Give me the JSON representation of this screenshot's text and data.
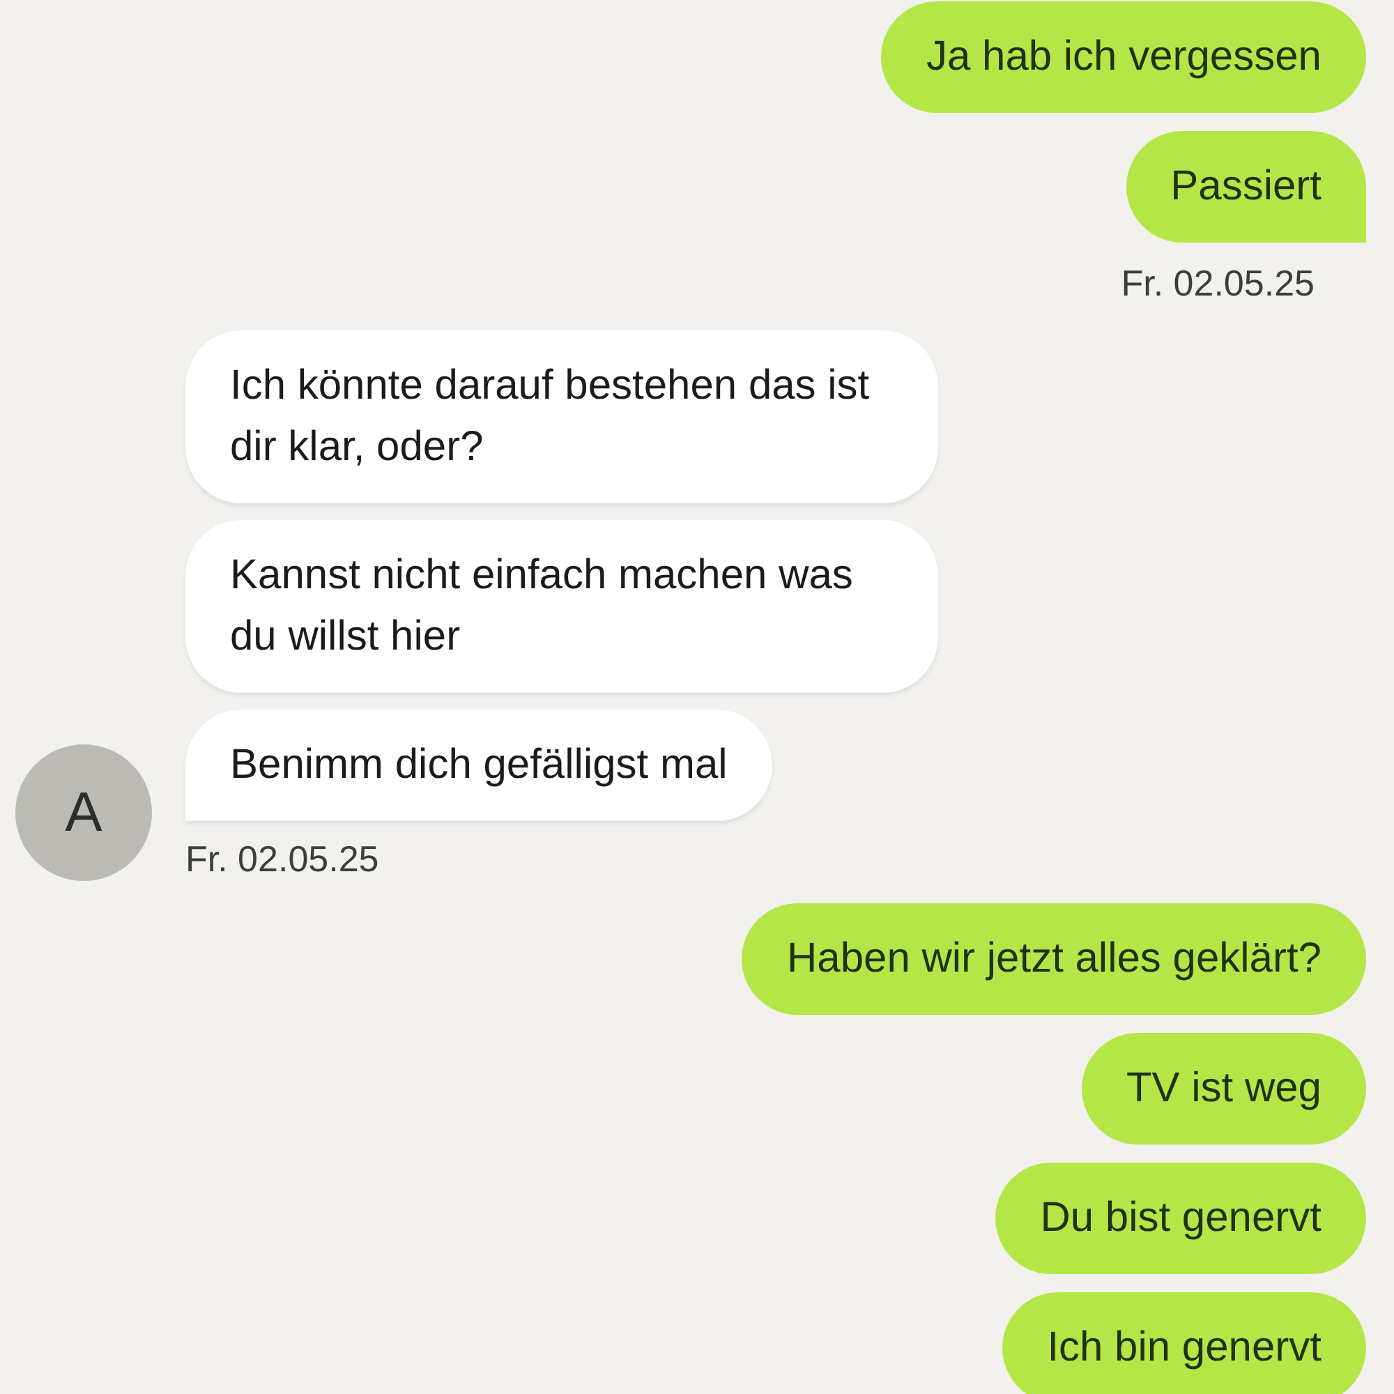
{
  "groups": [
    {
      "kind": "outgoing",
      "messages": [
        {
          "text": "Ja hab ich vergessen",
          "tail": false
        },
        {
          "text": "Passiert",
          "tail": true
        }
      ],
      "time": "Fr. 02.05.25"
    },
    {
      "kind": "incoming",
      "avatar": "A",
      "messages": [
        {
          "text": "Ich könnte darauf bestehen das ist dir klar, oder?",
          "tail": false
        },
        {
          "text": "Kannst nicht einfach machen was du willst hier",
          "tail": false
        },
        {
          "text": "Benimm dich gefälligst mal",
          "tail": true
        }
      ],
      "time": "Fr. 02.05.25"
    },
    {
      "kind": "outgoing",
      "messages": [
        {
          "text": "Haben wir jetzt alles geklärt?",
          "tail": false
        },
        {
          "text": "TV ist weg",
          "tail": false
        },
        {
          "text": "Du bist genervt",
          "tail": false
        },
        {
          "text": "Ich bin genervt",
          "tail": false
        }
      ]
    }
  ]
}
